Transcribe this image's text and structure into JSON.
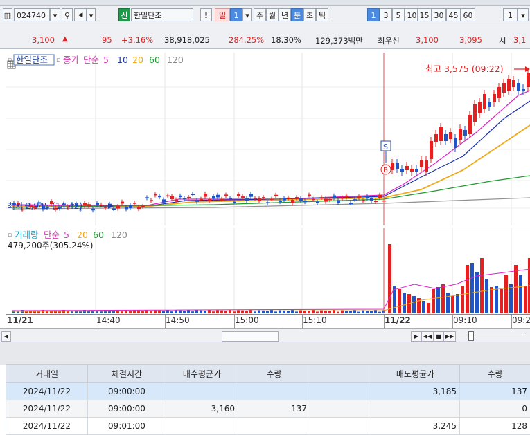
{
  "toolbar": {
    "code": "024740",
    "stock_name_badge": "신",
    "stock_name": "한일단조",
    "exclaim": "!",
    "period_day": "일",
    "period_num": "1",
    "buttons": [
      "주",
      "월",
      "년",
      "분",
      "초",
      "틱"
    ],
    "minute_active": "1",
    "minutes": [
      "3",
      "5",
      "10",
      "15",
      "30",
      "45",
      "60"
    ],
    "right_value": "1"
  },
  "quote": {
    "price": "3,100",
    "change": "95",
    "change_pct": "+3.16%",
    "volume": "38,918,025",
    "vol_ratio": "284.25%",
    "turnover": "18.30%",
    "amount": "129,373백만",
    "bid_label": "최우선",
    "bid": "3,100",
    "ask": "3,095",
    "open_label": "시",
    "open": "3,1"
  },
  "price_legend": {
    "name": "한일단조",
    "series": "종가",
    "ma_label": "단순",
    "ma_periods": [
      "5",
      "10",
      "20",
      "60",
      "120"
    ],
    "high_note": "최고 3,575 (09:22)",
    "low_note": "최저 2,945 (14:42)"
  },
  "volume_legend": {
    "name": "거래량",
    "ma_label": "단순",
    "ma_periods": [
      "5",
      "20",
      "60",
      "120"
    ],
    "current": "479,200주(305.24%)"
  },
  "markers": {
    "sell": "S",
    "buy": "B"
  },
  "x_axis": [
    "11/21",
    "14:40",
    "14:50",
    "15:00",
    "15:10",
    "11/22",
    "09:10",
    "09:2"
  ],
  "colors": {
    "up": "#e52020",
    "down": "#1f55c7",
    "ma5": "#e020c8",
    "ma10": "#1a2fb0",
    "ma20": "#f0a818",
    "ma60": "#1f9a2f",
    "ma120": "#909090",
    "vline": "#e05050"
  },
  "table": {
    "headers": [
      "거래일",
      "체결시간",
      "매수평균가",
      "수량",
      "",
      "매도평균가",
      "수량"
    ],
    "rows": [
      [
        "2024/11/22",
        "09:00:00",
        "",
        "",
        "",
        "3,185",
        "137"
      ],
      [
        "2024/11/22",
        "09:00:00",
        "3,160",
        "137",
        "",
        "",
        "0"
      ],
      [
        "2024/11/22",
        "09:01:00",
        "",
        "",
        "",
        "3,245",
        "128"
      ]
    ]
  }
}
